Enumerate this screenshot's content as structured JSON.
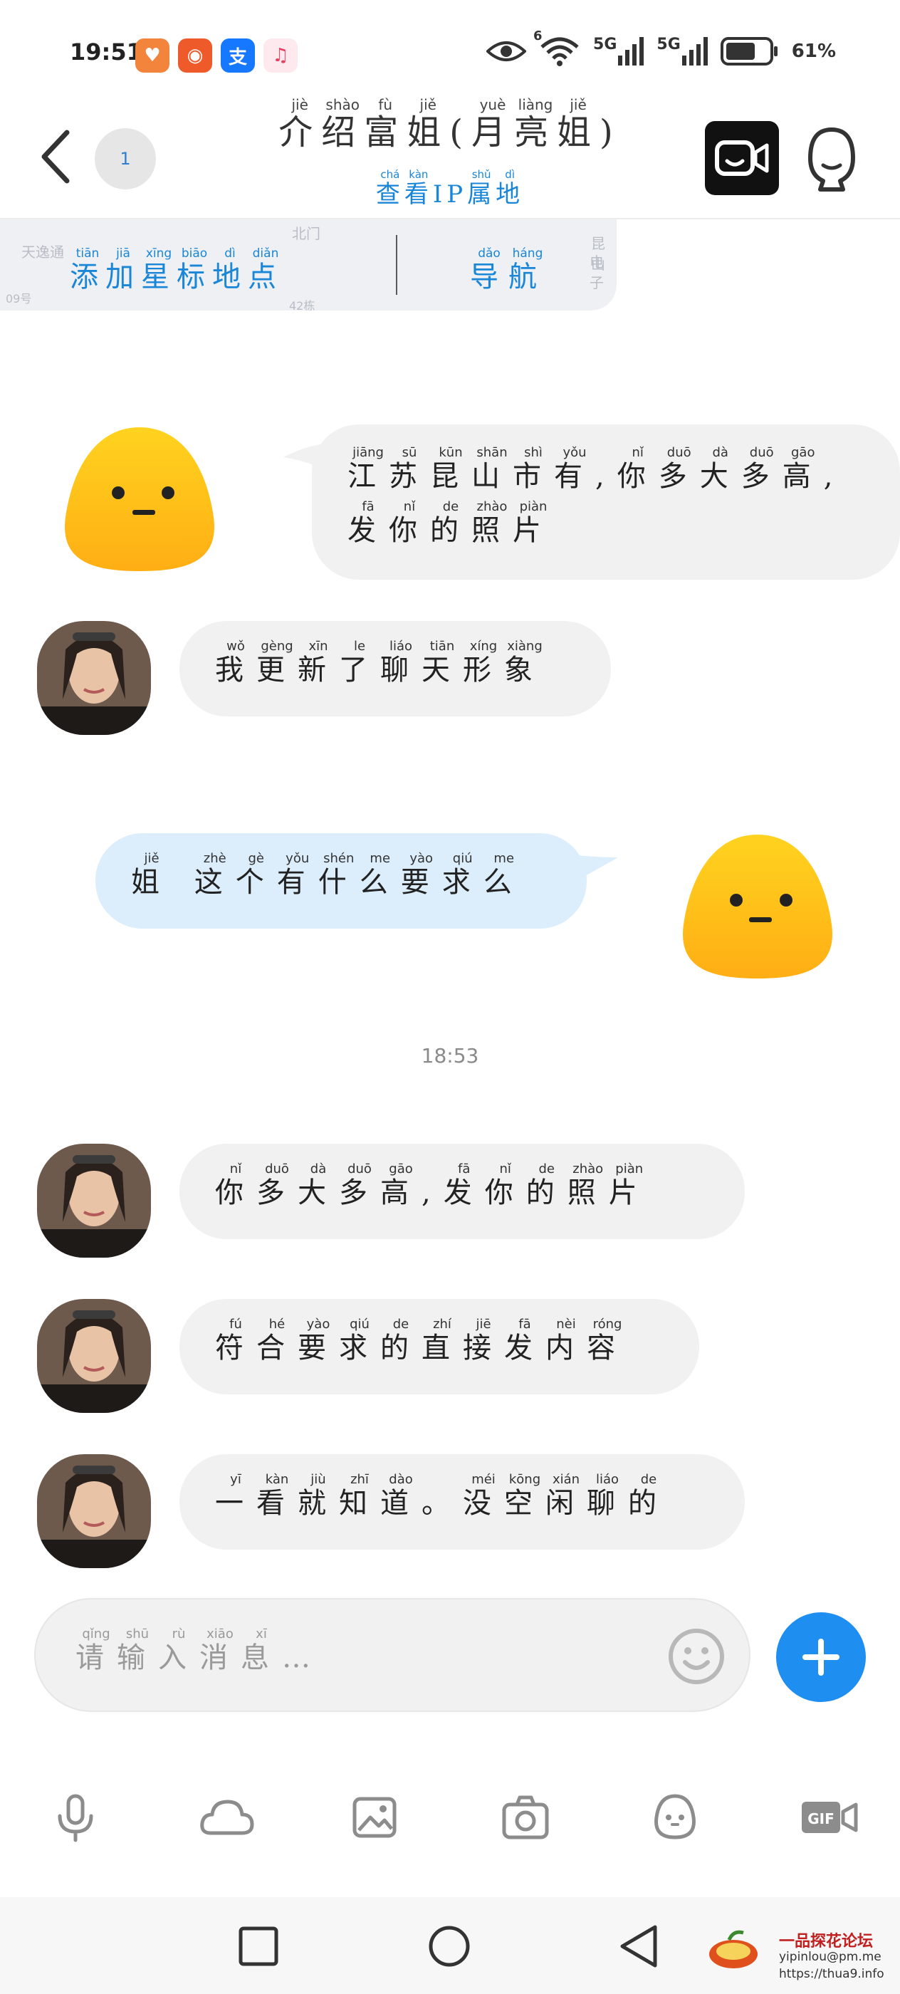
{
  "status_bar": {
    "time": "19:51",
    "battery": "61%",
    "network_1": "5G",
    "network_2": "5G",
    "wifi_label": "6",
    "app_icons": [
      {
        "name": "heart-app-icon",
        "color": "#f2843b",
        "glyph": "♥"
      },
      {
        "name": "kuaishou-app-icon",
        "color": "#ef5a2a",
        "glyph": "◉"
      },
      {
        "name": "alipay-app-icon",
        "color": "#1677ff",
        "glyph": "支"
      },
      {
        "name": "music-app-icon",
        "color": "#fde9ee",
        "glyph": "♫"
      }
    ]
  },
  "header": {
    "title": [
      {
        "c": "介",
        "p": "jiè"
      },
      {
        "c": "绍",
        "p": "shào"
      },
      {
        "c": "富",
        "p": "fù"
      },
      {
        "c": "姐",
        "p": "jiě"
      },
      {
        "c": "(",
        "p": ""
      },
      {
        "c": "月",
        "p": "yuè"
      },
      {
        "c": "亮",
        "p": "liàng"
      },
      {
        "c": "姐",
        "p": "jiě"
      },
      {
        "c": ")",
        "p": ""
      }
    ],
    "subtitle": [
      {
        "c": "查",
        "p": "chá"
      },
      {
        "c": "看",
        "p": "kàn"
      },
      {
        "c": "IP",
        "p": ""
      },
      {
        "c": "属",
        "p": "shǔ"
      },
      {
        "c": "地",
        "p": "dì"
      }
    ],
    "unread_count": "1"
  },
  "map_card": {
    "add_star": [
      {
        "c": "添",
        "p": "tiān"
      },
      {
        "c": "加",
        "p": "jiā"
      },
      {
        "c": "星",
        "p": "xīng"
      },
      {
        "c": "标",
        "p": "biāo"
      },
      {
        "c": "地",
        "p": "dì"
      },
      {
        "c": "点",
        "p": "diǎn"
      }
    ],
    "navigate": [
      {
        "c": "导",
        "p": "dǎo"
      },
      {
        "c": "航",
        "p": "háng"
      }
    ],
    "map_labels": [
      "天逸通",
      "北门",
      "42栋",
      "昆山",
      "电子",
      "09号"
    ]
  },
  "messages": [
    {
      "side": "right",
      "sender": "me",
      "text": [
        {
          "c": "江",
          "p": "jiāng"
        },
        {
          "c": "苏",
          "p": "sū"
        },
        {
          "c": "昆",
          "p": "kūn"
        },
        {
          "c": "山",
          "p": "shān"
        },
        {
          "c": "市",
          "p": "shì"
        },
        {
          "c": "有",
          "p": "yǒu"
        },
        {
          "c": ",",
          "p": ""
        },
        {
          "c": "你",
          "p": "nǐ"
        },
        {
          "c": "多",
          "p": "duō"
        },
        {
          "c": "大",
          "p": "dà"
        },
        {
          "c": "多",
          "p": "duō"
        },
        {
          "c": "高",
          "p": "gāo"
        },
        {
          "c": ",",
          "p": ""
        },
        {
          "c": "发",
          "p": "fā"
        },
        {
          "c": "你",
          "p": "nǐ"
        },
        {
          "c": "的",
          "p": "de"
        },
        {
          "c": "照",
          "p": "zhào"
        },
        {
          "c": "片",
          "p": "piàn"
        }
      ]
    },
    {
      "side": "left",
      "sender": "other",
      "text": [
        {
          "c": "我",
          "p": "wǒ"
        },
        {
          "c": "更",
          "p": "gèng"
        },
        {
          "c": "新",
          "p": "xīn"
        },
        {
          "c": "了",
          "p": "le"
        },
        {
          "c": "聊",
          "p": "liáo"
        },
        {
          "c": "天",
          "p": "tiān"
        },
        {
          "c": "形",
          "p": "xíng"
        },
        {
          "c": "象",
          "p": "xiàng"
        }
      ]
    },
    {
      "side": "right",
      "sender": "me",
      "text": [
        {
          "c": "姐",
          "p": "jiě"
        },
        {
          "c": " ",
          "p": ""
        },
        {
          "c": "这",
          "p": "zhè"
        },
        {
          "c": "个",
          "p": "gè"
        },
        {
          "c": "有",
          "p": "yǒu"
        },
        {
          "c": "什",
          "p": "shén"
        },
        {
          "c": "么",
          "p": "me"
        },
        {
          "c": "要",
          "p": "yào"
        },
        {
          "c": "求",
          "p": "qiú"
        },
        {
          "c": "么",
          "p": "me"
        }
      ]
    },
    {
      "side": "left",
      "sender": "other",
      "text": [
        {
          "c": "你",
          "p": "nǐ"
        },
        {
          "c": "多",
          "p": "duō"
        },
        {
          "c": "大",
          "p": "dà"
        },
        {
          "c": "多",
          "p": "duō"
        },
        {
          "c": "高",
          "p": "gāo"
        },
        {
          "c": ",",
          "p": ""
        },
        {
          "c": "发",
          "p": "fā"
        },
        {
          "c": "你",
          "p": "nǐ"
        },
        {
          "c": "的",
          "p": "de"
        },
        {
          "c": "照",
          "p": "zhào"
        },
        {
          "c": "片",
          "p": "piàn"
        }
      ]
    },
    {
      "side": "left",
      "sender": "other",
      "text": [
        {
          "c": "符",
          "p": "fú"
        },
        {
          "c": "合",
          "p": "hé"
        },
        {
          "c": "要",
          "p": "yào"
        },
        {
          "c": "求",
          "p": "qiú"
        },
        {
          "c": "的",
          "p": "de"
        },
        {
          "c": "直",
          "p": "zhí"
        },
        {
          "c": "接",
          "p": "jiē"
        },
        {
          "c": "发",
          "p": "fā"
        },
        {
          "c": "内",
          "p": "nèi"
        },
        {
          "c": "容",
          "p": "róng"
        }
      ]
    },
    {
      "side": "left",
      "sender": "other",
      "text": [
        {
          "c": "一",
          "p": "yī"
        },
        {
          "c": "看",
          "p": "kàn"
        },
        {
          "c": "就",
          "p": "jiù"
        },
        {
          "c": "知",
          "p": "zhī"
        },
        {
          "c": "道",
          "p": "dào"
        },
        {
          "c": "。",
          "p": ""
        },
        {
          "c": "没",
          "p": "méi"
        },
        {
          "c": "空",
          "p": "kōng"
        },
        {
          "c": "闲",
          "p": "xián"
        },
        {
          "c": "聊",
          "p": "liáo"
        },
        {
          "c": "的",
          "p": "de"
        }
      ]
    }
  ],
  "timestamp": "18:53",
  "input": {
    "placeholder": [
      {
        "c": "请",
        "p": "qǐng"
      },
      {
        "c": "输",
        "p": "shū"
      },
      {
        "c": "入",
        "p": "rù"
      },
      {
        "c": "消",
        "p": "xiāo"
      },
      {
        "c": "息",
        "p": "xī"
      },
      {
        "c": "…",
        "p": ""
      }
    ]
  },
  "toolbar": [
    "microphone-icon",
    "cloud-icon",
    "image-icon",
    "camera-icon",
    "sticker-icon",
    "gif-icon"
  ],
  "watermark": {
    "line1": "一品探花论坛",
    "line2": "yipinlou@pm.me",
    "line3": "https://thua9.info"
  },
  "colors": {
    "accent": "#1f8ef1",
    "link_blue": "#1a86d8",
    "bubble_gray": "#f1f1f1",
    "bubble_blue": "#dcedfc",
    "blob_yellow": "#ffc21a"
  }
}
